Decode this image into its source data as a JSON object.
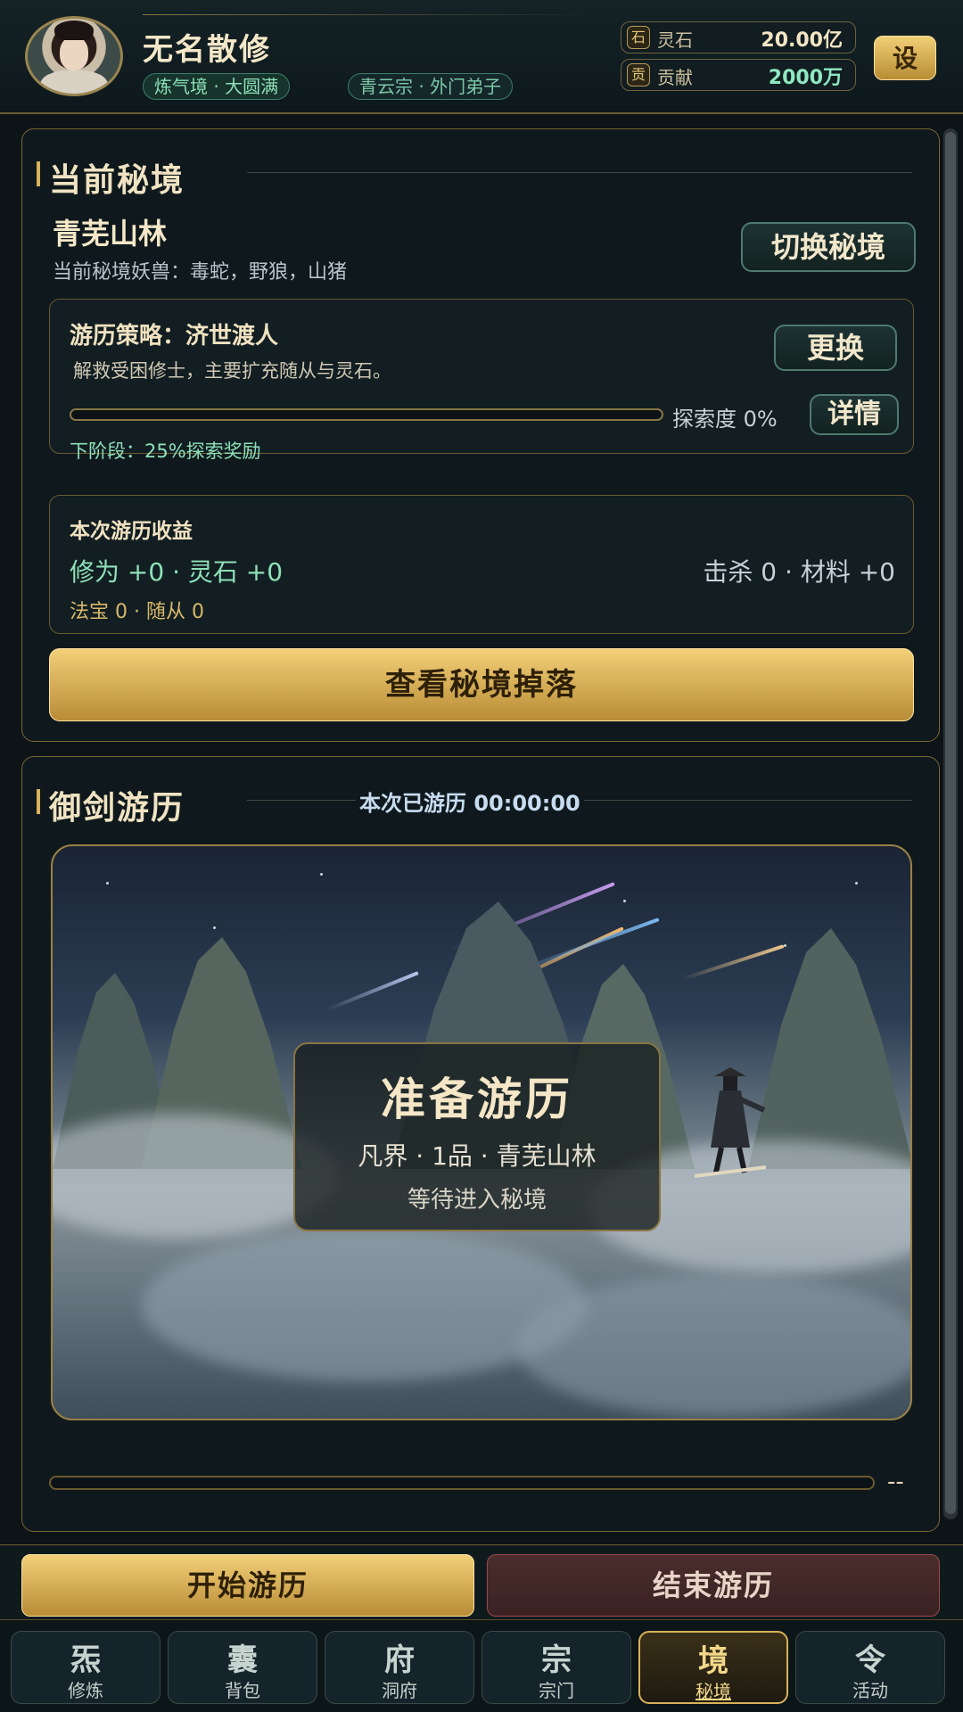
{
  "header": {
    "player_name": "无名散修",
    "realm_tag": "炼气境 · 大圆满",
    "sect_tag": "青云宗 · 外门弟子",
    "resources": [
      {
        "icon_char": "石",
        "label": "灵石",
        "value": "20.00亿"
      },
      {
        "icon_char": "贡",
        "label": "贡献",
        "value": "2000万"
      }
    ],
    "settings_label": "设"
  },
  "secret_realm": {
    "title": "当前秘境",
    "name": "青芜山林",
    "monsters": "当前秘境妖兽：毒蛇，野狼，山猪",
    "switch_label": "切换秘境",
    "strategy": {
      "title": "游历策略：济世渡人",
      "desc": "解救受困修士，主要扩充随从与灵石。",
      "change_label": "更换",
      "detail_label": "详情",
      "explore_text": "探索度 0%",
      "explore_percent": 0,
      "next_stage": "下阶段：25%探索奖励"
    },
    "income": {
      "title": "本次游历收益",
      "main": "修为 +0 · 灵石 +0",
      "right": "击杀 0 · 材料 +0",
      "small": "法宝 0 · 随从 0"
    },
    "drops_label": "查看秘境掉落"
  },
  "journey": {
    "title": "御剑游历",
    "timer": "本次已游历 00:00:00",
    "scene_title": "准备游历",
    "scene_sub": "凡界 · 1品 · 青芜山林",
    "scene_wait": "等待进入秘境",
    "progress_text": "--"
  },
  "actions": {
    "start_label": "开始游历",
    "end_label": "结束游历"
  },
  "nav": [
    {
      "glyph": "炁",
      "label": "修炼"
    },
    {
      "glyph": "囊",
      "label": "背包"
    },
    {
      "glyph": "府",
      "label": "洞府"
    },
    {
      "glyph": "宗",
      "label": "宗门"
    },
    {
      "glyph": "境",
      "label": "秘境",
      "active": true
    },
    {
      "glyph": "令",
      "label": "活动"
    }
  ],
  "colors": {
    "gold": "#f0d58c",
    "jade": "#8fe0b8",
    "bg": "#0c1418",
    "danger": "#9a4a4a"
  }
}
